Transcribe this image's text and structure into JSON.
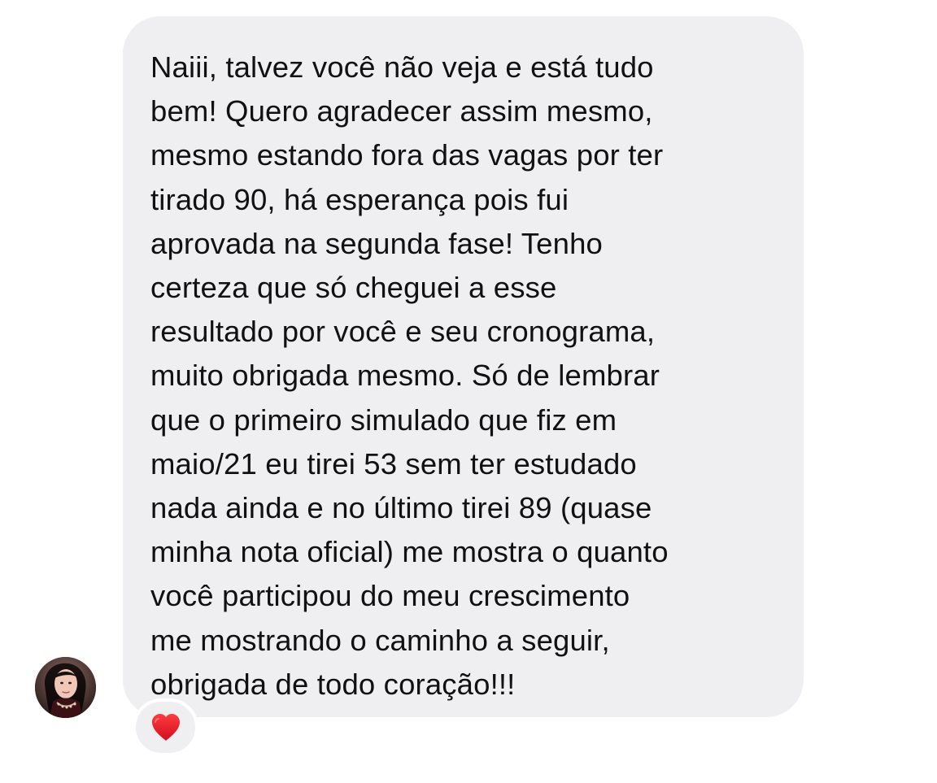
{
  "message": {
    "lines": [
      "Naiii, talvez você não veja e está tudo",
      "bem! Quero agradecer assim mesmo,",
      "mesmo estando fora das vagas por ter",
      "tirado 90, há esperança pois fui",
      "aprovada na segunda fase! Tenho",
      "certeza que só cheguei a esse",
      "resultado por você e seu cronograma,",
      "muito obrigada mesmo. Só de lembrar",
      "que o primeiro simulado que fiz em",
      "maio/21 eu tirei 53 sem ter estudado",
      "nada ainda e no último tirei 89 (quase",
      "minha nota oficial) me mostra o quanto",
      "você participou do meu crescimento",
      "me mostrando o caminho a seguir,",
      "obrigada de todo coração!!!"
    ]
  },
  "reaction": {
    "icon": "heart-icon",
    "color": "#e51b2b"
  },
  "avatar": {
    "icon": "profile-avatar"
  },
  "colors": {
    "bubble_background": "#efeff1",
    "text": "#111111",
    "page_background": "#ffffff"
  }
}
